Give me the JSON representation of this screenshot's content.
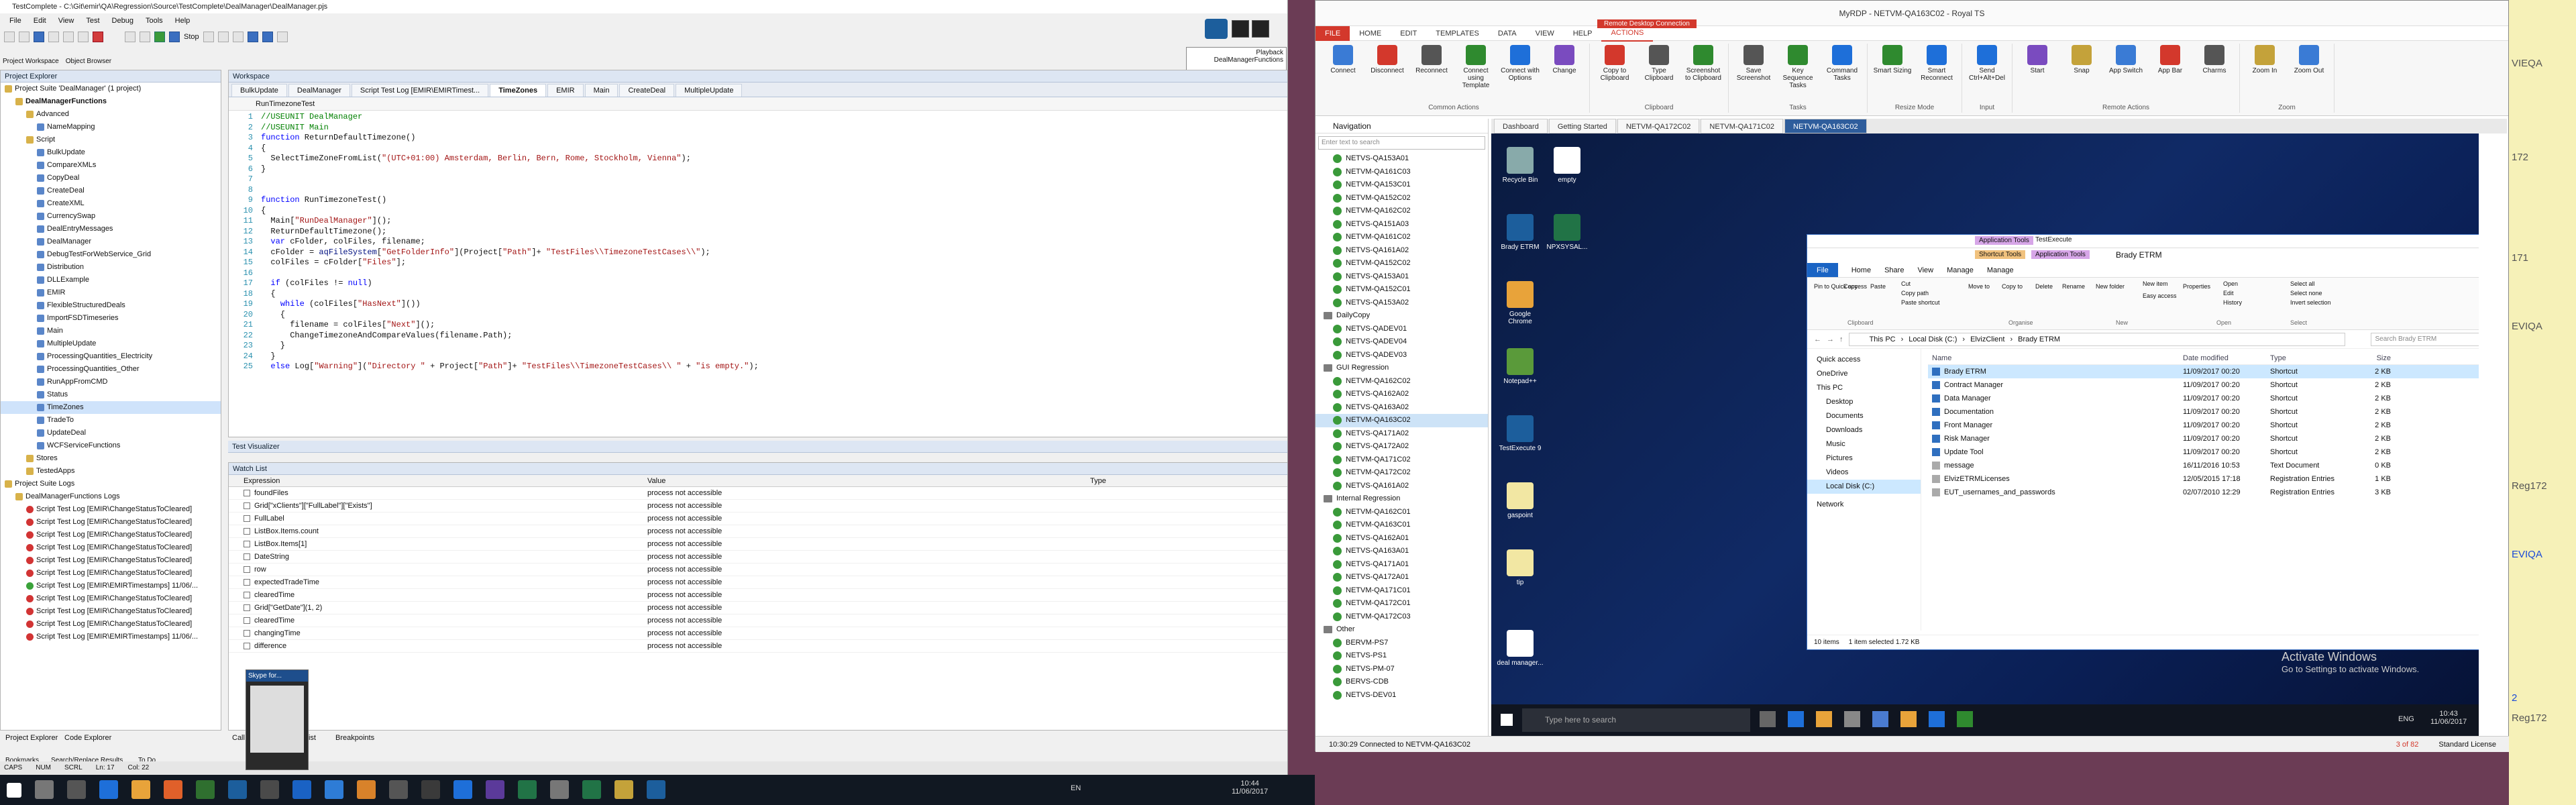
{
  "tc": {
    "title": "TestComplete - C:\\Git\\emir\\QA\\Regression\\Source\\TestComplete\\DealManager\\DealManager.pjs",
    "menu": [
      "File",
      "Edit",
      "View",
      "Test",
      "Debug",
      "Tools",
      "Help"
    ],
    "playback_label": "Playback",
    "playback_item": "DealManagerFunctions",
    "stop_label": "Stop",
    "project_explorer_title": "Project Explorer",
    "object_browser_tab": "Object Browser",
    "project_workspace_tab": "Project Workspace",
    "tree": [
      {
        "label": "Project Suite 'DealManager' (1 project)",
        "indent": 0
      },
      {
        "label": "DealManagerFunctions",
        "indent": 1,
        "bold": true
      },
      {
        "label": "Advanced",
        "indent": 2
      },
      {
        "label": "NameMapping",
        "indent": 3
      },
      {
        "label": "Script",
        "indent": 2
      },
      {
        "label": "BulkUpdate",
        "indent": 3
      },
      {
        "label": "CompareXMLs",
        "indent": 3
      },
      {
        "label": "CopyDeal",
        "indent": 3
      },
      {
        "label": "CreateDeal",
        "indent": 3
      },
      {
        "label": "CreateXML",
        "indent": 3
      },
      {
        "label": "CurrencySwap",
        "indent": 3
      },
      {
        "label": "DealEntryMessages",
        "indent": 3
      },
      {
        "label": "DealManager",
        "indent": 3
      },
      {
        "label": "DebugTestForWebService_Grid",
        "indent": 3
      },
      {
        "label": "Distribution",
        "indent": 3
      },
      {
        "label": "DLLExample",
        "indent": 3
      },
      {
        "label": "EMIR",
        "indent": 3
      },
      {
        "label": "FlexibleStructuredDeals",
        "indent": 3
      },
      {
        "label": "ImportFSDTimeseries",
        "indent": 3
      },
      {
        "label": "Main",
        "indent": 3
      },
      {
        "label": "MultipleUpdate",
        "indent": 3
      },
      {
        "label": "ProcessingQuantities_Electricity",
        "indent": 3
      },
      {
        "label": "ProcessingQuantities_Other",
        "indent": 3
      },
      {
        "label": "RunAppFromCMD",
        "indent": 3
      },
      {
        "label": "Status",
        "indent": 3
      },
      {
        "label": "TimeZones",
        "indent": 3,
        "selected": true
      },
      {
        "label": "TradeTo",
        "indent": 3
      },
      {
        "label": "UpdateDeal",
        "indent": 3
      },
      {
        "label": "WCFServiceFunctions",
        "indent": 3
      },
      {
        "label": "Stores",
        "indent": 2
      },
      {
        "label": "TestedApps",
        "indent": 2
      },
      {
        "label": "Project Suite Logs",
        "indent": 0
      },
      {
        "label": "DealManagerFunctions Logs",
        "indent": 1
      },
      {
        "label": "Script Test Log [EMIR\\ChangeStatusToCleared]",
        "indent": 2,
        "status": "fail"
      },
      {
        "label": "Script Test Log [EMIR\\ChangeStatusToCleared]",
        "indent": 2,
        "status": "fail"
      },
      {
        "label": "Script Test Log [EMIR\\ChangeStatusToCleared]",
        "indent": 2,
        "status": "fail"
      },
      {
        "label": "Script Test Log [EMIR\\ChangeStatusToCleared]",
        "indent": 2,
        "status": "fail"
      },
      {
        "label": "Script Test Log [EMIR\\ChangeStatusToCleared]",
        "indent": 2,
        "status": "fail"
      },
      {
        "label": "Script Test Log [EMIR\\ChangeStatusToCleared]",
        "indent": 2,
        "status": "fail"
      },
      {
        "label": "Script Test Log [EMIR\\EMIRTimestamps] 11/06/...",
        "indent": 2,
        "status": "ok"
      },
      {
        "label": "Script Test Log [EMIR\\ChangeStatusToCleared]",
        "indent": 2,
        "status": "fail"
      },
      {
        "label": "Script Test Log [EMIR\\ChangeStatusToCleared]",
        "indent": 2,
        "status": "fail"
      },
      {
        "label": "Script Test Log [EMIR\\ChangeStatusToCleared]",
        "indent": 2,
        "status": "fail"
      },
      {
        "label": "Script Test Log [EMIR\\EMIRTimestamps] 11/06/...",
        "indent": 2,
        "status": "fail"
      }
    ],
    "workspace_title": "Workspace",
    "doc_tabs": [
      "BulkUpdate",
      "DealManager",
      "Script Test Log [EMIR\\EMIRTimest...",
      "TimeZones",
      "EMIR",
      "Main",
      "CreateDeal",
      "MultipleUpdate"
    ],
    "active_doc_tab": 3,
    "routine": "RunTimezoneTest",
    "code_lines": [
      {
        "n": "1",
        "html": "<span class='cm'>//USEUNIT DealManager</span>"
      },
      {
        "n": "2",
        "html": "<span class='cm'>//USEUNIT Main</span>"
      },
      {
        "n": "3",
        "html": "<span class='kw'>function</span> ReturnDefaultTimezone()"
      },
      {
        "n": "4",
        "html": "{"
      },
      {
        "n": "5",
        "html": "  SelectTimeZoneFromList(<span class='st'>\"(UTC+01:00) Amsterdam, Berlin, Bern, Rome, Stockholm, Vienna\"</span>);"
      },
      {
        "n": "6",
        "html": "}"
      },
      {
        "n": "7",
        "html": ""
      },
      {
        "n": "8",
        "html": ""
      },
      {
        "n": "9",
        "html": "<span class='kw'>function</span> RunTimezoneTest()"
      },
      {
        "n": "10",
        "html": "{"
      },
      {
        "n": "11",
        "html": "  Main[<span class='st'>\"RunDealManager\"</span>]();"
      },
      {
        "n": "12",
        "html": "  ReturnDefaultTimezone();"
      },
      {
        "n": "13",
        "html": "  <span class='kw'>var</span> cFolder, colFiles, filename;"
      },
      {
        "n": "14",
        "html": "  cFolder = <span class='id'>aqFileSystem</span>[<span class='st'>\"GetFolderInfo\"</span>](Project[<span class='st'>\"Path\"</span>]+ <span class='st'>\"TestFiles\\\\TimezoneTestCases\\\\\"</span>);"
      },
      {
        "n": "15",
        "html": "  colFiles = cFolder[<span class='st'>\"Files\"</span>];"
      },
      {
        "n": "16",
        "html": ""
      },
      {
        "n": "17",
        "html": "  <span class='kw'>if</span> (colFiles != <span class='kw'>null</span>)"
      },
      {
        "n": "18",
        "html": "  {"
      },
      {
        "n": "19",
        "html": "    <span class='kw'>while</span> (colFiles[<span class='st'>\"HasNext\"</span>]())"
      },
      {
        "n": "20",
        "html": "    {"
      },
      {
        "n": "21",
        "html": "      filename = colFiles[<span class='st'>\"Next\"</span>]();"
      },
      {
        "n": "22",
        "html": "      ChangeTimezoneAndCompareValues(filename.Path);"
      },
      {
        "n": "23",
        "html": "    }"
      },
      {
        "n": "24",
        "html": "  }"
      },
      {
        "n": "25",
        "html": "  <span class='kw'>else</span> Log[<span class='st'>\"Warning\"</span>](<span class='st'>\"Directory \"</span> + Project[<span class='st'>\"Path\"</span>]+ <span class='st'>\"TestFiles\\\\TimezoneTestCases\\\\ \"</span> + <span class='st'>\"is empty.\"</span>);"
      }
    ],
    "test_visualizer_title": "Test Visualizer",
    "watch_title": "Watch List",
    "watch_cols": [
      "Expression",
      "Value",
      "Type"
    ],
    "watch_rows": [
      {
        "e": "foundFiles",
        "v": "process not accessible"
      },
      {
        "e": "Grid[\"xClients\"][\"FullLabel\"][\"Exists\"]",
        "v": "process not accessible"
      },
      {
        "e": "FullLabel",
        "v": "process not accessible"
      },
      {
        "e": "ListBox.Items.count",
        "v": "process not accessible"
      },
      {
        "e": "ListBox.Items[1]",
        "v": "process not accessible"
      },
      {
        "e": "DateString",
        "v": "process not accessible"
      },
      {
        "e": "row",
        "v": "process not accessible"
      },
      {
        "e": "expectedTradeTime",
        "v": "process not accessible"
      },
      {
        "e": "clearedTime",
        "v": "process not accessible"
      },
      {
        "e": "Grid[\"GetDate\"](1, 2)",
        "v": "process not accessible"
      },
      {
        "e": "clearedTime",
        "v": "process not accessible"
      },
      {
        "e": "changingTime",
        "v": "process not accessible"
      },
      {
        "e": "difference",
        "v": "process not accessible"
      }
    ],
    "bottom_tabs": [
      "Project Explorer",
      "Code Explorer"
    ],
    "bottom_tabs2": [
      "Call Stack",
      "Watch List",
      "Breakpoints"
    ],
    "status_tabs": [
      "Bookmarks",
      "Search/Replace Results",
      "To Do"
    ],
    "status": [
      "CAPS",
      "NUM",
      "SCRL",
      "Ln: 17",
      "Col: 22"
    ],
    "skype_label": "Skype for..."
  },
  "taskbar_left": {
    "lang": "EN",
    "time": "10:44",
    "date": "11/06/2017"
  },
  "rdp": {
    "title": "MyRDP - NETVM-QA163C02 - Royal TS",
    "context_tab": "Remote Desktop Connection",
    "ribbon_tabs": [
      "FILE",
      "HOME",
      "EDIT",
      "TEMPLATES",
      "DATA",
      "VIEW",
      "HELP",
      "ACTIONS"
    ],
    "groups": [
      {
        "name": "Common Actions",
        "buttons": [
          "Connect",
          "Disconnect",
          "Reconnect",
          "Connect using Template",
          "Connect with Options",
          "Change"
        ]
      },
      {
        "name": "Clipboard",
        "buttons": [
          "Copy to Clipboard",
          "Type Clipboard",
          "Screenshot to Clipboard"
        ]
      },
      {
        "name": "Tasks",
        "buttons": [
          "Save Screenshot",
          "Key Sequence Tasks",
          "Command Tasks"
        ]
      },
      {
        "name": "Resize Mode",
        "buttons": [
          "Smart Sizing",
          "Smart Reconnect"
        ]
      },
      {
        "name": "Input",
        "buttons": [
          "Send Ctrl+Alt+Del"
        ]
      },
      {
        "name": "Remote Actions",
        "buttons": [
          "Start",
          "Snap",
          "App Switch",
          "App Bar",
          "Charms"
        ]
      },
      {
        "name": "Zoom",
        "buttons": [
          "Zoom In",
          "Zoom Out"
        ]
      }
    ],
    "nav_title": "Navigation",
    "nav_search": "Enter text to search",
    "nav_items": [
      {
        "t": "NETVS-QA153A01",
        "k": "c"
      },
      {
        "t": "NETVM-QA161C03",
        "k": "c"
      },
      {
        "t": "NETVM-QA153C01",
        "k": "c"
      },
      {
        "t": "NETVM-QA152C02",
        "k": "c"
      },
      {
        "t": "NETVM-QA162C02",
        "k": "c"
      },
      {
        "t": "NETVS-QA151A03",
        "k": "c"
      },
      {
        "t": "NETVM-QA161C02",
        "k": "c"
      },
      {
        "t": "NETVS-QA161A02",
        "k": "c"
      },
      {
        "t": "NETVM-QA152C02",
        "k": "c"
      },
      {
        "t": "NETVS-QA153A01",
        "k": "c"
      },
      {
        "t": "NETVM-QA152C01",
        "k": "c"
      },
      {
        "t": "NETVS-QA153A02",
        "k": "c"
      },
      {
        "t": "DailyCopy",
        "k": "f"
      },
      {
        "t": "NETVS-QADEV01",
        "k": "c"
      },
      {
        "t": "NETVS-QADEV04",
        "k": "c"
      },
      {
        "t": "NETVS-QADEV03",
        "k": "c"
      },
      {
        "t": "GUI Regression",
        "k": "f"
      },
      {
        "t": "NETVM-QA162C02",
        "k": "c"
      },
      {
        "t": "NETVS-QA162A02",
        "k": "c"
      },
      {
        "t": "NETVS-QA163A02",
        "k": "c"
      },
      {
        "t": "NETVM-QA163C02",
        "k": "c",
        "sel": true
      },
      {
        "t": "NETVS-QA171A02",
        "k": "c"
      },
      {
        "t": "NETVS-QA172A02",
        "k": "c"
      },
      {
        "t": "NETVM-QA171C02",
        "k": "c"
      },
      {
        "t": "NETVM-QA172C02",
        "k": "c"
      },
      {
        "t": "NETVS-QA161A02",
        "k": "c"
      },
      {
        "t": "Internal Regression",
        "k": "f"
      },
      {
        "t": "NETVM-QA162C01",
        "k": "c"
      },
      {
        "t": "NETVM-QA163C01",
        "k": "c"
      },
      {
        "t": "NETVS-QA162A01",
        "k": "c"
      },
      {
        "t": "NETVS-QA163A01",
        "k": "c"
      },
      {
        "t": "NETVS-QA171A01",
        "k": "c"
      },
      {
        "t": "NETVS-QA172A01",
        "k": "c"
      },
      {
        "t": "NETVM-QA171C01",
        "k": "c"
      },
      {
        "t": "NETVM-QA172C01",
        "k": "c"
      },
      {
        "t": "NETVM-QA172C03",
        "k": "c"
      },
      {
        "t": "Other",
        "k": "f"
      },
      {
        "t": "BERVM-PS7",
        "k": "c"
      },
      {
        "t": "NETVS-PS1",
        "k": "c"
      },
      {
        "t": "NETVS-PM-07",
        "k": "c"
      },
      {
        "t": "BERVS-CDB",
        "k": "c"
      },
      {
        "t": "NETVS-DEV01",
        "k": "c"
      }
    ],
    "conn_tabs": [
      "Dashboard",
      "Getting Started",
      "NETVM-QA172C02",
      "NETVM-QA171C02",
      "NETVM-QA163C02"
    ],
    "active_conn": 4,
    "status_text": "10:30:29 Connected to NETVM-QA163C02",
    "status_right": "3 of 82",
    "license": "Standard License"
  },
  "remote": {
    "desktop_icons": [
      "Recycle Bin",
      "empty",
      "Brady ETRM",
      "NPXSYSAL...",
      "Google Chrome",
      "Notepad++",
      "TestExecute 9",
      "gaspoint",
      "tip",
      "deal manager..."
    ],
    "watermark_title": "Activate Windows",
    "watermark_text": "Go to Settings to activate Windows.",
    "taskbar_search": "Type here to search",
    "time": "10:43",
    "date": "11/06/2017",
    "lang": "ENG"
  },
  "explorer": {
    "title": "Brady ETRM",
    "ctx_tabs": [
      "Application Tools",
      "TestExecute"
    ],
    "ctx_sub": [
      "Shortcut Tools",
      "Application Tools"
    ],
    "tabs": [
      "File",
      "Home",
      "Share",
      "View",
      "Manage",
      "Manage"
    ],
    "ribbon_groups": [
      "Clipboard",
      "Organise",
      "New",
      "Open",
      "Select"
    ],
    "ribbon_buttons": [
      "Pin to Quick access",
      "Copy",
      "Paste",
      "Cut",
      "Copy path",
      "Paste shortcut",
      "Move to",
      "Copy to",
      "Delete",
      "Rename",
      "New folder",
      "New item",
      "Easy access",
      "Properties",
      "Open",
      "Edit",
      "History",
      "Select all",
      "Select none",
      "Invert selection"
    ],
    "path": [
      "This PC",
      "Local Disk (C:)",
      "ElvizClient",
      "Brady ETRM"
    ],
    "search_ph": "Search Brady ETRM",
    "sidebar": [
      "Quick access",
      "OneDrive",
      "This PC",
      "Desktop",
      "Documents",
      "Downloads",
      "Music",
      "Pictures",
      "Videos",
      "Local Disk (C:)",
      "Network"
    ],
    "cols": [
      "Name",
      "Date modified",
      "Type",
      "Size"
    ],
    "files": [
      {
        "n": "Brady ETRM",
        "d": "11/09/2017 00:20",
        "t": "Shortcut",
        "s": "2 KB",
        "sel": true
      },
      {
        "n": "Contract Manager",
        "d": "11/09/2017 00:20",
        "t": "Shortcut",
        "s": "2 KB"
      },
      {
        "n": "Data Manager",
        "d": "11/09/2017 00:20",
        "t": "Shortcut",
        "s": "2 KB"
      },
      {
        "n": "Documentation",
        "d": "11/09/2017 00:20",
        "t": "Shortcut",
        "s": "2 KB"
      },
      {
        "n": "Front Manager",
        "d": "11/09/2017 00:20",
        "t": "Shortcut",
        "s": "2 KB"
      },
      {
        "n": "Risk Manager",
        "d": "11/09/2017 00:20",
        "t": "Shortcut",
        "s": "2 KB"
      },
      {
        "n": "Update Tool",
        "d": "11/09/2017 00:20",
        "t": "Shortcut",
        "s": "2 KB"
      },
      {
        "n": "message",
        "d": "16/11/2016 10:53",
        "t": "Text Document",
        "s": "0 KB"
      },
      {
        "n": "ElvizETRMLicenses",
        "d": "12/05/2015 17:18",
        "t": "Registration Entries",
        "s": "1 KB"
      },
      {
        "n": "EUT_usernames_and_passwords",
        "d": "02/07/2010 12:29",
        "t": "Registration Entries",
        "s": "3 KB"
      }
    ],
    "status": [
      "10 items",
      "1 item selected 1.72 KB"
    ]
  },
  "strip": {
    "lines": [
      "VIEQA",
      "172",
      "171",
      "EVIQA",
      "Reg172",
      "EVIQA",
      "2",
      "Reg172"
    ]
  }
}
